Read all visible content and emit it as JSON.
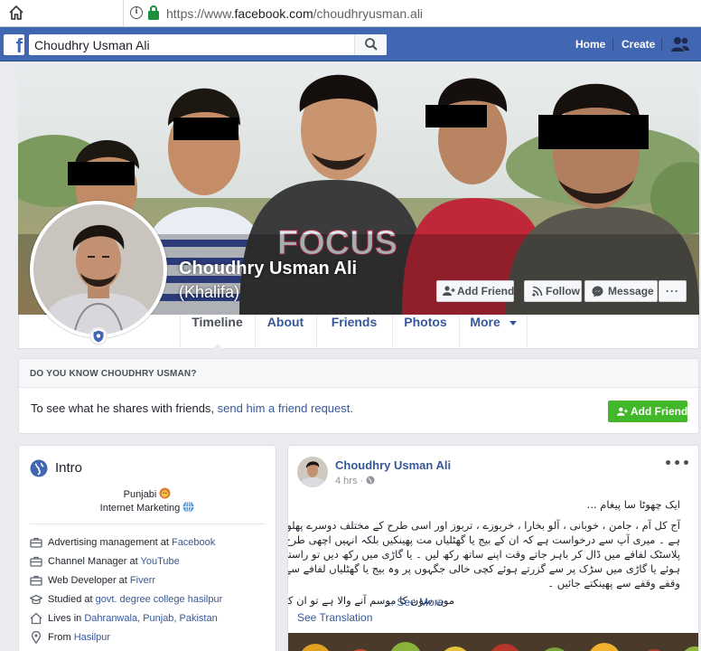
{
  "browser": {
    "url_prefix": "https://www.",
    "url_domain": "facebook.com",
    "url_path": "/choudhryusman.ali"
  },
  "topbar": {
    "logo": "f",
    "search_value": "Choudhry Usman Ali",
    "nav": [
      "Home",
      "Create"
    ]
  },
  "profile": {
    "name": "Choudhry Usman Ali",
    "alternate_name": "(Khalifa)",
    "actions": {
      "add_friend": "Add Friend",
      "follow": "Follow",
      "message": "Message",
      "more": "···"
    }
  },
  "tabs": [
    "Timeline",
    "About",
    "Friends",
    "Photos",
    "More"
  ],
  "know_box": {
    "header": "DO YOU KNOW CHOUDHRY USMAN?",
    "text": "To see what he shares with friends, ",
    "link": "send him a friend request.",
    "button": "Add Friend"
  },
  "intro": {
    "title": "Intro",
    "lines": [
      "Punjabi",
      "Internet Marketing"
    ],
    "items": [
      {
        "icon": "briefcase-icon",
        "text": "Advertising management at ",
        "link": "Facebook"
      },
      {
        "icon": "briefcase-icon",
        "text": "Channel Manager at ",
        "link": "YouTube"
      },
      {
        "icon": "briefcase-icon",
        "text": "Web Developer at ",
        "link": "Fiverr"
      },
      {
        "icon": "graduation-cap-icon",
        "text": "Studied at ",
        "link": "govt. degree college hasilpur"
      },
      {
        "icon": "home-icon",
        "text": "Lives in ",
        "link": "Dahranwala, Punjab, Pakistan"
      },
      {
        "icon": "location-pin-icon",
        "text": "From ",
        "link": "Hasilpur"
      }
    ]
  },
  "post": {
    "author": "Choudhry Usman Ali",
    "time": "4 hrs · ",
    "menu": "•••",
    "lines": [
      "ایک چھوٹا سا پیغام ...",
      "آج کل آم ، جامن ، خوبانی ، آلو بخارا ، خربوزے ، تربوز اور اسی طرح کے مختلف دوسرے پھلوں کا موسم",
      "ہے ۔ میری آپ سے درخواست ہے کہ ان کے بیج یا گھٹلیاں مت پھینکیں بلکہ انہیں اچھی طرح دھو کر ایک",
      "پلاسٹک لفافے میں ڈال کر باہر جاتے وقت اپنے ساتھ رکھ لیں ۔ یا گاڑی میں رکھ دیں تو راستے میں چلتے",
      "ہوئے یا گاڑی میں سڑک پر سے گزرتے ہوئے کچی خالی جگہوں پر وہ بیج یا گھٹلیاں لفافے سے نکال کر",
      "وقفے وقفے سے پھینکتے جائیں ۔",
      "مون سون کا موسم آنے والا ہے تو ان کے بڑھنے میں آسانی ہو ج"
    ],
    "see_more": "... See More",
    "see_translation": "See Translation"
  },
  "colors": {
    "facebook_blue": "#4267b2",
    "link": "#365899",
    "green": "#42b72a"
  }
}
